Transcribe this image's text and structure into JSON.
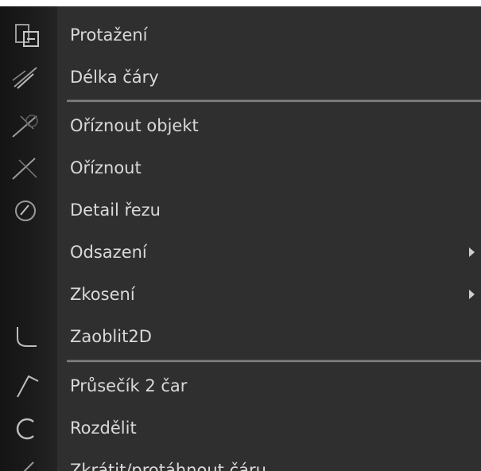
{
  "menu": {
    "items": [
      {
        "label": "Protažení",
        "icon": "stretch-icon",
        "submenu": false
      },
      {
        "label": "Délka čáry",
        "icon": "lengthen-icon",
        "submenu": false
      },
      {
        "label": "Oříznout objekt",
        "icon": "trim-object-icon",
        "submenu": false
      },
      {
        "label": "Oříznout",
        "icon": "trim-icon",
        "submenu": false
      },
      {
        "label": "Detail řezu",
        "icon": "section-detail-icon",
        "submenu": false
      },
      {
        "label": "Odsazení",
        "icon": "",
        "submenu": true
      },
      {
        "label": "Zkosení",
        "icon": "",
        "submenu": true
      },
      {
        "label": "Zaoblit2D",
        "icon": "fillet-icon",
        "submenu": false
      },
      {
        "label": "Průsečík 2 čar",
        "icon": "intersection-icon",
        "submenu": false
      },
      {
        "label": "Rozdělit",
        "icon": "break-icon",
        "submenu": false
      },
      {
        "label": "Zkrátit/protáhnout čáru",
        "icon": "trim-extend-icon",
        "submenu": false
      }
    ]
  },
  "colors": {
    "background": "#2f2f2f",
    "icon_strip": "#1a1a1a",
    "text": "#d9d9d9",
    "separator": "#7f7f7f"
  }
}
